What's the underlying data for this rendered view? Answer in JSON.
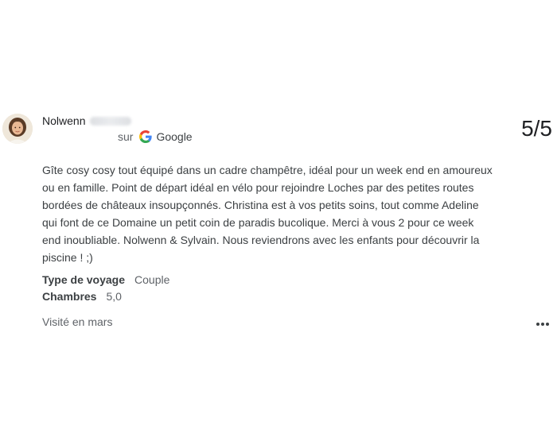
{
  "reviewer": {
    "first_name": "Nolwenn",
    "avatar_icon": "person-avatar-photo"
  },
  "source": {
    "prefix": "sur",
    "name": "Google",
    "icon": "google-g-icon"
  },
  "rating": "5/5",
  "review": {
    "text": "Gîte cosy cosy tout équipé dans un cadre champêtre, idéal pour un week end en amoureux\nou en famille. Point de départ idéal en vélo pour rejoindre Loches par des petites routes\nbordées de châteaux insoupçonnés. Christina est à vos petits soins, tout comme Adeline\nqui font de ce Domaine un petit coin de paradis bucolique. Merci à vous 2 pour ce week\nend inoubliable. Nolwenn & Sylvain. Nous reviendrons avec les enfants pour découvrir la\npiscine ! ;)"
  },
  "attributes": [
    {
      "label": "Type de voyage",
      "value": "Couple"
    },
    {
      "label": "Chambres",
      "value": "5,0"
    }
  ],
  "visit": "Visité en mars",
  "more_icon": "more-horizontal-icon",
  "colors": {
    "text_primary": "#202124",
    "text_secondary": "#5f6368",
    "google_blue": "#4285F4",
    "google_red": "#EA4335",
    "google_yellow": "#FBBC05",
    "google_green": "#34A853"
  }
}
